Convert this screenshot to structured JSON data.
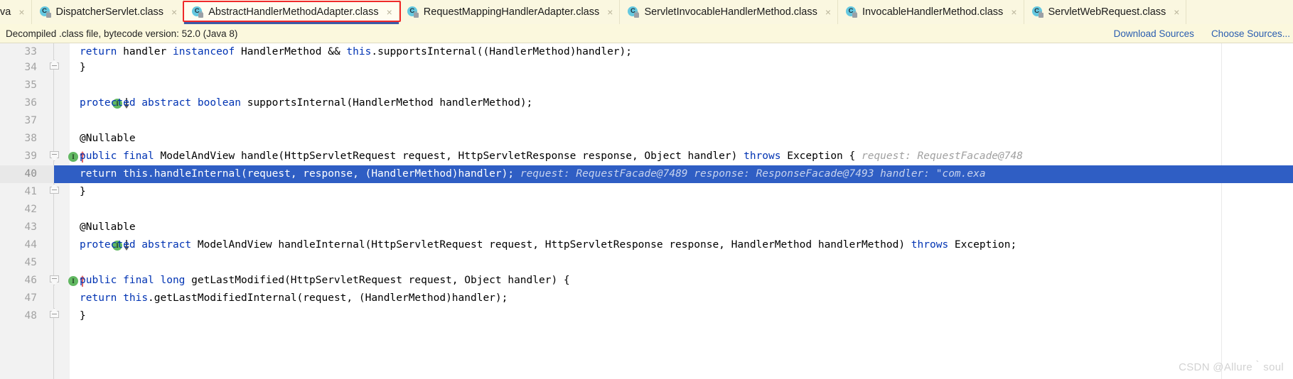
{
  "tabs": [
    {
      "label": "va",
      "icon": "java-class-icon",
      "clipped": true,
      "selected": false,
      "close": "×"
    },
    {
      "label": "DispatcherServlet.class",
      "icon": "java-class-icon",
      "clipped": false,
      "selected": false,
      "close": "×"
    },
    {
      "label": "AbstractHandlerMethodAdapter.class",
      "icon": "java-class-icon",
      "clipped": false,
      "selected": true,
      "close": "×"
    },
    {
      "label": "RequestMappingHandlerAdapter.class",
      "icon": "java-class-icon",
      "clipped": false,
      "selected": false,
      "close": "×"
    },
    {
      "label": "ServletInvocableHandlerMethod.class",
      "icon": "java-class-icon",
      "clipped": false,
      "selected": false,
      "close": "×"
    },
    {
      "label": "InvocableHandlerMethod.class",
      "icon": "java-class-icon",
      "clipped": false,
      "selected": false,
      "close": "×"
    },
    {
      "label": "ServletWebRequest.class",
      "icon": "java-class-icon",
      "clipped": false,
      "selected": false,
      "close": "×"
    }
  ],
  "tab_icon_letter": "C",
  "banner": {
    "message": "Decompiled .class file, bytecode version: 52.0 (Java 8)",
    "links": [
      {
        "label": "Download Sources"
      },
      {
        "label": "Choose Sources..."
      }
    ]
  },
  "colors": {
    "accent_blue": "#2a5db0",
    "selection_blue": "#2f5ec4",
    "keyword_blue": "#0033b3",
    "hint_gray": "#a0a0a0",
    "tab_highlight_red": "#ef2a2a",
    "tab_active_underline": "#3b5ba8",
    "impl_marker_green": "#62b862",
    "bulb_orange": "#f5a623"
  },
  "editor": {
    "lines": [
      {
        "number": "33",
        "partial_top": true,
        "tokens": [
          {
            "t": "        ",
            "c": "plain"
          },
          {
            "t": "return",
            "c": "kw"
          },
          {
            "t": " handler ",
            "c": "plain"
          },
          {
            "t": "instanceof",
            "c": "kw"
          },
          {
            "t": " HandlerMethod && ",
            "c": "plain"
          },
          {
            "t": "this",
            "c": "kw"
          },
          {
            "t": ".supportsInternal((HandlerMethod)handler);",
            "c": "plain"
          }
        ]
      },
      {
        "number": "34",
        "fold": "end",
        "tokens": [
          {
            "t": "    }",
            "c": "plain"
          }
        ]
      },
      {
        "number": "35",
        "tokens": []
      },
      {
        "number": "36",
        "marker": "impl-down",
        "tokens": [
          {
            "t": "    ",
            "c": "plain"
          },
          {
            "t": "protected abstract boolean",
            "c": "kw"
          },
          {
            "t": " supportsInternal(HandlerMethod handlerMethod);",
            "c": "plain"
          }
        ]
      },
      {
        "number": "37",
        "tokens": []
      },
      {
        "number": "38",
        "tokens": [
          {
            "t": "    @Nullable",
            "c": "annot"
          }
        ]
      },
      {
        "number": "39",
        "marker": "impl-up",
        "fold": "start",
        "tokens": [
          {
            "t": "    ",
            "c": "plain"
          },
          {
            "t": "public final",
            "c": "kw"
          },
          {
            "t": " ModelAndView handle(HttpServletRequest request, HttpServletResponse response, Object handler) ",
            "c": "plain"
          },
          {
            "t": "throws",
            "c": "kw"
          },
          {
            "t": " Exception {",
            "c": "plain"
          },
          {
            "t": "   request:  RequestFacade@748",
            "c": "hint"
          }
        ]
      },
      {
        "number": "40",
        "selected": true,
        "bulb": true,
        "tokens": [
          {
            "t": "        ",
            "c": "plain"
          },
          {
            "t": "return",
            "c": "kw"
          },
          {
            "t": " ",
            "c": "plain"
          },
          {
            "t": "this",
            "c": "kw"
          },
          {
            "t": ".handleInternal(request, response, (HandlerMethod)handler);",
            "c": "plain"
          },
          {
            "t": "   request:  RequestFacade@7489    response:  ResponseFacade@7493    handler:  \"com.exa",
            "c": "hint"
          }
        ]
      },
      {
        "number": "41",
        "fold": "end",
        "tokens": [
          {
            "t": "    }",
            "c": "plain"
          }
        ]
      },
      {
        "number": "42",
        "tokens": []
      },
      {
        "number": "43",
        "tokens": [
          {
            "t": "    @Nullable",
            "c": "annot"
          }
        ]
      },
      {
        "number": "44",
        "marker": "impl-down",
        "tokens": [
          {
            "t": "    ",
            "c": "plain"
          },
          {
            "t": "protected abstract",
            "c": "kw"
          },
          {
            "t": " ModelAndView handleInternal(HttpServletRequest request, HttpServletResponse response, HandlerMethod handlerMethod) ",
            "c": "plain"
          },
          {
            "t": "throws",
            "c": "kw"
          },
          {
            "t": " Exception;",
            "c": "plain"
          }
        ]
      },
      {
        "number": "45",
        "tokens": []
      },
      {
        "number": "46",
        "marker": "impl-up",
        "fold": "start",
        "tokens": [
          {
            "t": "    ",
            "c": "plain"
          },
          {
            "t": "public final long",
            "c": "kw"
          },
          {
            "t": " getLastModified(HttpServletRequest request, Object handler) {",
            "c": "plain"
          }
        ]
      },
      {
        "number": "47",
        "tokens": [
          {
            "t": "        ",
            "c": "plain"
          },
          {
            "t": "return",
            "c": "kw"
          },
          {
            "t": " ",
            "c": "plain"
          },
          {
            "t": "this",
            "c": "kw"
          },
          {
            "t": ".getLastModifiedInternal(request, (HandlerMethod)handler);",
            "c": "plain"
          }
        ]
      },
      {
        "number": "48",
        "fold": "end",
        "tokens": [
          {
            "t": "    }",
            "c": "plain"
          }
        ]
      }
    ]
  },
  "watermark": "CSDN @Allure｀soul"
}
